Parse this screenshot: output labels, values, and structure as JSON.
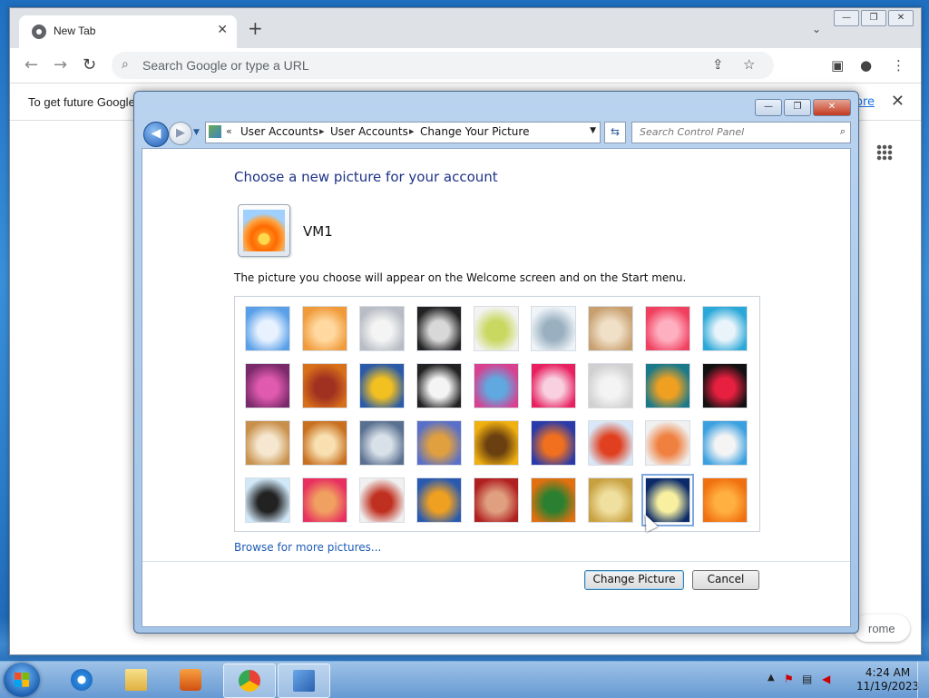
{
  "chrome": {
    "tab_title": "New Tab",
    "tab_close": "✕",
    "new_tab": "+",
    "tab_search": "⌄",
    "omnibox_placeholder": "Search Google or type a URL",
    "infobar_message": "To get future Google",
    "infobar_link": "ore",
    "infobar_close": "✕",
    "bottom_pill_text": "rome",
    "window_controls": [
      "—",
      "❐",
      "✕"
    ]
  },
  "control_panel": {
    "window_controls": [
      "—",
      "❐",
      "✕"
    ],
    "breadcrumb": [
      "«",
      "User Accounts",
      "User Accounts",
      "Change Your Picture"
    ],
    "search_placeholder": "Search Control Panel",
    "heading": "Choose a new picture for your account",
    "username": "VM1",
    "description": "The picture you choose will appear on the Welcome screen and on the Start menu.",
    "browse_link": "Browse for more pictures...",
    "change_button": "Change Picture",
    "cancel_button": "Cancel",
    "pictures": [
      {
        "name": "roller-coaster",
        "colors": [
          "#5aa0e8",
          "#e8f2ff"
        ]
      },
      {
        "name": "starfish",
        "colors": [
          "#f09a3a",
          "#ffd9a0"
        ]
      },
      {
        "name": "robot-toy",
        "colors": [
          "#b8bcc4",
          "#f4f4f4"
        ]
      },
      {
        "name": "turntable",
        "colors": [
          "#222",
          "#d8d8d8"
        ]
      },
      {
        "name": "lucky-cat",
        "colors": [
          "#f3f3f3",
          "#c8d860"
        ]
      },
      {
        "name": "gyroscope",
        "colors": [
          "#eef4f8",
          "#9ab0c0"
        ]
      },
      {
        "name": "kitten",
        "colors": [
          "#c8a070",
          "#f0e0c8"
        ]
      },
      {
        "name": "pink-flower",
        "colors": [
          "#f04060",
          "#ffb0c0"
        ]
      },
      {
        "name": "pinwheel",
        "colors": [
          "#2aa8d8",
          "#e8f4fa"
        ]
      },
      {
        "name": "ball-pattern",
        "colors": [
          "#7a2a6a",
          "#e05ab0"
        ]
      },
      {
        "name": "fabric",
        "colors": [
          "#d8701a",
          "#a03020"
        ]
      },
      {
        "name": "ginkgo-leaf",
        "colors": [
          "#2a5aa8",
          "#f2c020"
        ]
      },
      {
        "name": "dog",
        "colors": [
          "#222",
          "#f4f4f4"
        ]
      },
      {
        "name": "crayons",
        "colors": [
          "#d84090",
          "#60a8e0"
        ]
      },
      {
        "name": "pink-star",
        "colors": [
          "#e82060",
          "#f8d0e0"
        ]
      },
      {
        "name": "jacks",
        "colors": [
          "#d0d0d0",
          "#f4f4f4"
        ]
      },
      {
        "name": "stairs",
        "colors": [
          "#1a7a8a",
          "#f0a020"
        ]
      },
      {
        "name": "origami-crane",
        "colors": [
          "#111",
          "#e82040"
        ]
      },
      {
        "name": "guitar",
        "colors": [
          "#c8904a",
          "#f6e8d0"
        ]
      },
      {
        "name": "puppy",
        "colors": [
          "#c87020",
          "#f8e0b0"
        ]
      },
      {
        "name": "robot",
        "colors": [
          "#5a7090",
          "#d8e0e8"
        ]
      },
      {
        "name": "scarf",
        "colors": [
          "#5a70c8",
          "#e0a040"
        ]
      },
      {
        "name": "sunflower",
        "colors": [
          "#f0b010",
          "#6a4010"
        ]
      },
      {
        "name": "fish",
        "colors": [
          "#2a3aa8",
          "#f07020"
        ]
      },
      {
        "name": "balloon",
        "colors": [
          "#d8e8f8",
          "#e04020"
        ]
      },
      {
        "name": "toy-figure",
        "colors": [
          "#f0f0f0",
          "#f08040"
        ]
      },
      {
        "name": "sailboat",
        "colors": [
          "#3aa0e0",
          "#f4f4f4"
        ]
      },
      {
        "name": "soccer-ball",
        "colors": [
          "#d0e8f8",
          "#222"
        ]
      },
      {
        "name": "towels",
        "colors": [
          "#e83060",
          "#f0a060"
        ]
      },
      {
        "name": "marbles",
        "colors": [
          "#f0f0f0",
          "#c03020"
        ]
      },
      {
        "name": "window",
        "colors": [
          "#2a5ab0",
          "#f0a020"
        ]
      },
      {
        "name": "textile",
        "colors": [
          "#b02020",
          "#e0a080"
        ]
      },
      {
        "name": "butterfly",
        "colors": [
          "#e07010",
          "#2a8030"
        ]
      },
      {
        "name": "spiral",
        "colors": [
          "#c8a040",
          "#f0e0a0"
        ]
      },
      {
        "name": "lighthouse",
        "colors": [
          "#0a2a6a",
          "#f8f0a0"
        ]
      },
      {
        "name": "orange-flower",
        "colors": [
          "#f07010",
          "#ffb040"
        ]
      }
    ],
    "selected_index": 34
  },
  "taskbar": {
    "items": [
      "internet-explorer",
      "file-explorer",
      "media-player",
      "chrome",
      "control-panel"
    ],
    "time": "4:24 AM",
    "date": "11/19/2023"
  }
}
